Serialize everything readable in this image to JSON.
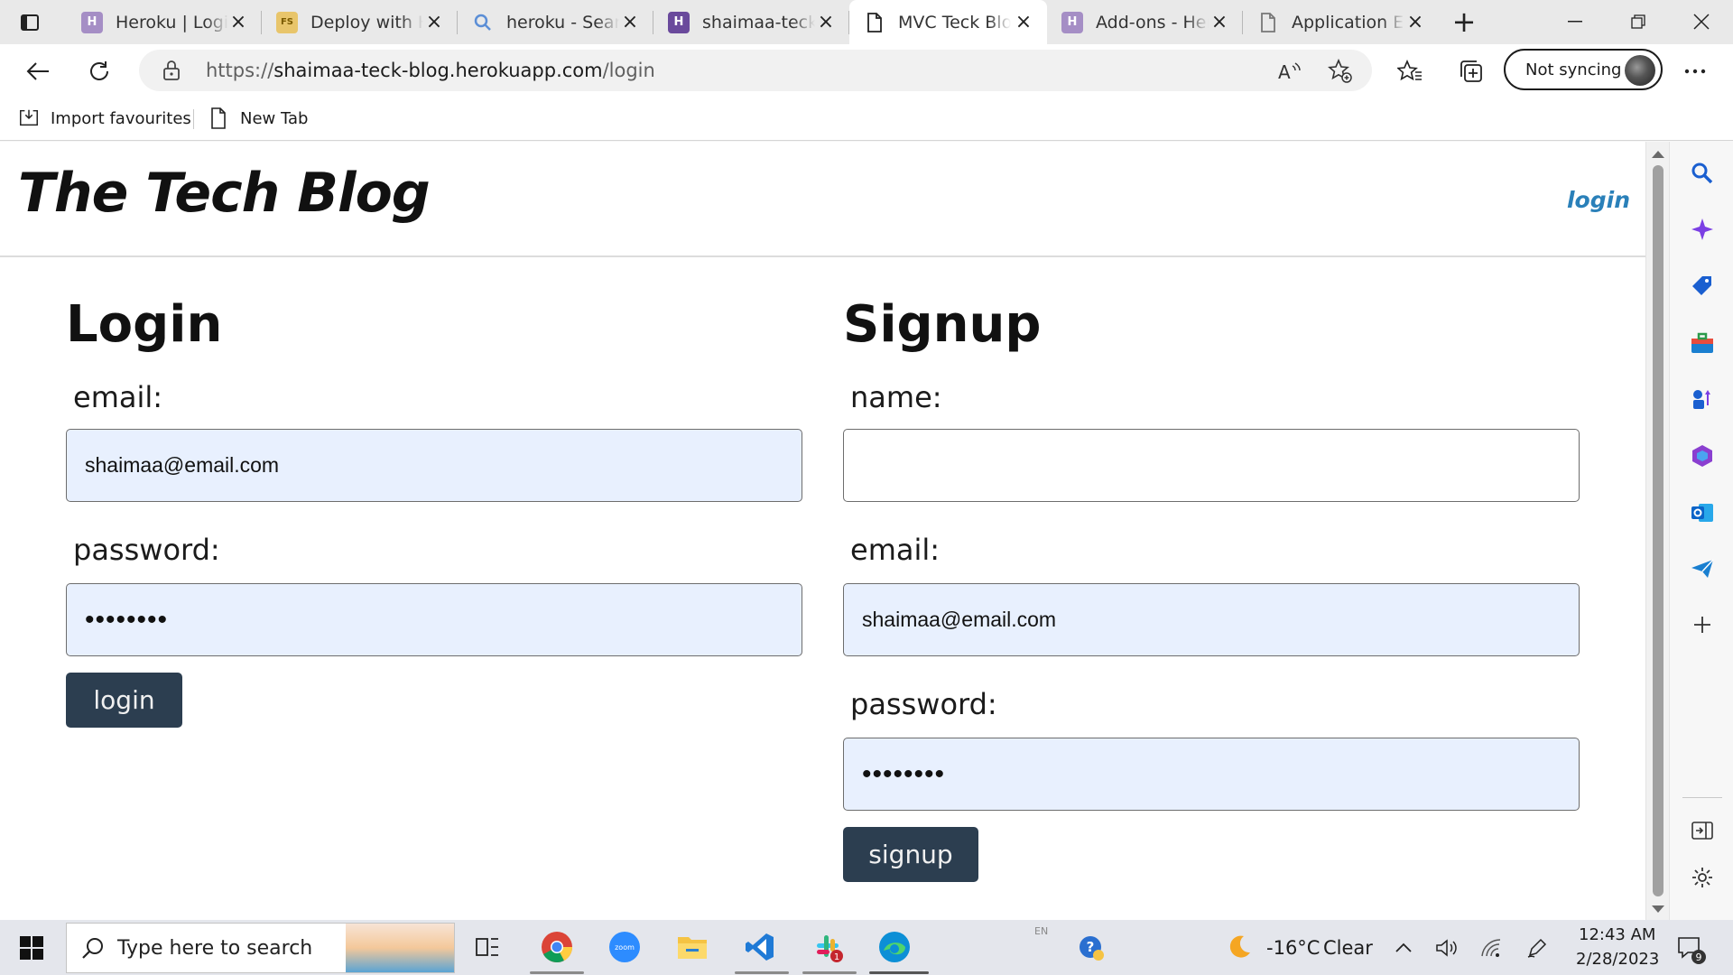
{
  "browser": {
    "tabs": [
      {
        "title": "Heroku | Login",
        "icon": "heroku-favicon",
        "active": false
      },
      {
        "title": "Deploy with Heroku",
        "icon": "deploy-favicon",
        "active": false
      },
      {
        "title": "heroku - Search",
        "icon": "search-favicon",
        "active": false
      },
      {
        "title": "shaimaa-teck-blog",
        "icon": "heroku-favicon",
        "active": false
      },
      {
        "title": "MVC Teck Blog",
        "icon": "page-favicon",
        "active": true
      },
      {
        "title": "Add-ons - Heroku",
        "icon": "heroku-favicon",
        "active": false
      },
      {
        "title": "Application Error",
        "icon": "page-favicon",
        "active": false
      }
    ],
    "address": {
      "scheme": "https://",
      "host": "shaimaa-teck-blog.herokuapp.com",
      "path": "/login"
    },
    "sync_label": "Not syncing",
    "favourites": [
      {
        "label": "Import favourites",
        "icon": "import-icon"
      },
      {
        "label": "New Tab",
        "icon": "page-icon"
      }
    ]
  },
  "site": {
    "title": "The Tech Blog",
    "nav_login": "login"
  },
  "login_form": {
    "heading": "Login",
    "email_label": "email:",
    "email_value": "shaimaa@email.com",
    "password_label": "password:",
    "password_value": "••••••••",
    "button_label": "login"
  },
  "signup_form": {
    "heading": "Signup",
    "name_label": "name:",
    "name_value": "",
    "email_label": "email:",
    "email_value": "shaimaa@email.com",
    "password_label": "password:",
    "password_value": "••••••••",
    "button_label": "signup"
  },
  "taskbar": {
    "search_placeholder": "Type here to search",
    "weather_temp": "-16°C",
    "weather_desc": "Clear",
    "time": "12:43 AM",
    "date": "2/28/2023",
    "lang": "EN",
    "slack_badge": "1",
    "notification_count": "9"
  },
  "colors": {
    "accent_link": "#2a80b9",
    "button_bg": "#2c3e50",
    "autofill_bg": "#e8f0fe"
  }
}
